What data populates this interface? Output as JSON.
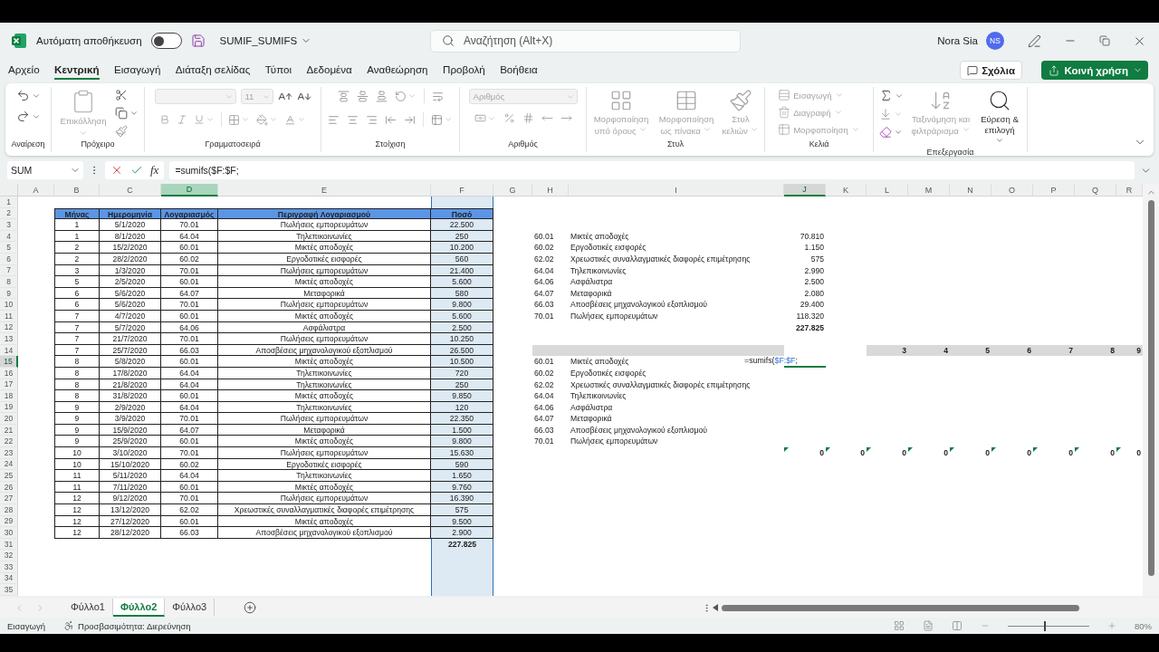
{
  "window": {
    "autosave_label": "Αυτόματη αποθήκευση",
    "autosave_on": false,
    "filename": "SUMIF_SUMIFS",
    "search_placeholder": "Αναζήτηση (Alt+X)",
    "user_name": "Nora Sia",
    "user_initials": "NS"
  },
  "menu_tabs": [
    {
      "label": "Αρχείο",
      "selected": false
    },
    {
      "label": "Κεντρική",
      "selected": true
    },
    {
      "label": "Εισαγωγή",
      "selected": false
    },
    {
      "label": "Διάταξη σελίδας",
      "selected": false
    },
    {
      "label": "Τύποι",
      "selected": false
    },
    {
      "label": "Δεδομένα",
      "selected": false
    },
    {
      "label": "Αναθεώρηση",
      "selected": false
    },
    {
      "label": "Προβολή",
      "selected": false
    },
    {
      "label": "Βοήθεια",
      "selected": false
    }
  ],
  "header_buttons": {
    "comments": "Σχόλια",
    "share": "Κοινή χρήση"
  },
  "ribbon": {
    "groups": [
      {
        "kind": "undo",
        "label": "Αναίρεση"
      },
      {
        "kind": "clipboard",
        "label": "Πρόχειρο",
        "paste": {
          "label": "Επικόλληση",
          "disabled": true
        }
      },
      {
        "kind": "font",
        "label": "Γραμματοσειρά",
        "font_size": "11"
      },
      {
        "kind": "alignment",
        "label": "Στοίχιση"
      },
      {
        "kind": "number",
        "label": "Αριθμός",
        "format": "Αριθμός"
      },
      {
        "kind": "styles",
        "label": "Στυλ",
        "buttons": [
          {
            "label": "Μορφοποίηση υπό όρους",
            "disabled": true
          },
          {
            "label": "Μορφοποίηση ως πίνακα",
            "disabled": true
          },
          {
            "label": "Στυλ κελιών",
            "disabled": true
          }
        ]
      },
      {
        "kind": "cells",
        "label": "Κελιά",
        "buttons": [
          {
            "label": "Εισαγωγή",
            "disabled": true
          },
          {
            "label": "Διαγραφή",
            "disabled": true
          },
          {
            "label": "Μορφοποίηση",
            "disabled": true
          }
        ]
      },
      {
        "kind": "editing",
        "label": "Επεξεργασία",
        "buttons": [
          {
            "label": "Ταξινόμηση και φιλτράρισμα",
            "disabled": true
          },
          {
            "label": "Εύρεση & επιλογή",
            "disabled": false
          }
        ]
      }
    ]
  },
  "formula_bar": {
    "name_box": "SUM",
    "function_symbol": "fx",
    "formula": "=sumifs($F:$F;"
  },
  "columns": [
    {
      "label": "A",
      "selected": false,
      "active": false
    },
    {
      "label": "B",
      "selected": false,
      "active": false
    },
    {
      "label": "C",
      "selected": false,
      "active": false
    },
    {
      "label": "D",
      "selected": true,
      "active": false
    },
    {
      "label": "E",
      "selected": false,
      "active": false
    },
    {
      "label": "F",
      "selected": false,
      "active": false
    },
    {
      "label": "G",
      "selected": false,
      "active": false
    },
    {
      "label": "H",
      "selected": false,
      "active": false
    },
    {
      "label": "I",
      "selected": false,
      "active": false
    },
    {
      "label": "J",
      "selected": false,
      "active": true
    },
    {
      "label": "K",
      "selected": false,
      "active": false
    },
    {
      "label": "L",
      "selected": false,
      "active": false
    },
    {
      "label": "M",
      "selected": false,
      "active": false
    },
    {
      "label": "N",
      "selected": false,
      "active": false
    },
    {
      "label": "O",
      "selected": false,
      "active": false
    },
    {
      "label": "P",
      "selected": false,
      "active": false
    },
    {
      "label": "Q",
      "selected": false,
      "active": false
    },
    {
      "label": "R",
      "selected": false,
      "active": false
    }
  ],
  "rows": [
    {
      "label": "1",
      "active": false
    },
    {
      "label": "2",
      "active": false
    },
    {
      "label": "3",
      "active": false
    },
    {
      "label": "4",
      "active": false
    },
    {
      "label": "5",
      "active": false
    },
    {
      "label": "6",
      "active": false
    },
    {
      "label": "7",
      "active": false
    },
    {
      "label": "8",
      "active": false
    },
    {
      "label": "9",
      "active": false
    },
    {
      "label": "10",
      "active": false
    },
    {
      "label": "11",
      "active": false
    },
    {
      "label": "12",
      "active": false
    },
    {
      "label": "13",
      "active": false
    },
    {
      "label": "14",
      "active": false
    },
    {
      "label": "15",
      "active": true
    },
    {
      "label": "16",
      "active": false
    },
    {
      "label": "17",
      "active": false
    },
    {
      "label": "18",
      "active": false
    },
    {
      "label": "19",
      "active": false
    },
    {
      "label": "20",
      "active": false
    },
    {
      "label": "21",
      "active": false
    },
    {
      "label": "22",
      "active": false
    },
    {
      "label": "23",
      "active": false
    },
    {
      "label": "24",
      "active": false
    },
    {
      "label": "25",
      "active": false
    },
    {
      "label": "26",
      "active": false
    },
    {
      "label": "27",
      "active": false
    },
    {
      "label": "28",
      "active": false
    },
    {
      "label": "29",
      "active": false
    },
    {
      "label": "30",
      "active": false
    },
    {
      "label": "31",
      "active": false
    },
    {
      "label": "32",
      "active": false
    },
    {
      "label": "33",
      "active": false
    },
    {
      "label": "34",
      "active": false
    },
    {
      "label": "35",
      "active": false
    }
  ],
  "table": {
    "headers": [
      "Μήνας",
      "Ημερομηνία",
      "Λογαριασμός",
      "Περιγραφή Λογαριασμού",
      "Ποσό"
    ],
    "rows": [
      [
        "1",
        "5/1/2020",
        "70.01",
        "Πωλήσεις εμπορευμάτων",
        "22.500"
      ],
      [
        "1",
        "8/1/2020",
        "64.04",
        "Τηλεπικοινωνίες",
        "250"
      ],
      [
        "2",
        "15/2/2020",
        "60.01",
        "Μικτές αποδοχές",
        "10.200"
      ],
      [
        "2",
        "28/2/2020",
        "60.02",
        "Εργοδοτικές εισφορές",
        "560"
      ],
      [
        "3",
        "1/3/2020",
        "70.01",
        "Πωλήσεις εμπορευμάτων",
        "21.400"
      ],
      [
        "5",
        "2/5/2020",
        "60.01",
        "Μικτές αποδοχές",
        "5.600"
      ],
      [
        "6",
        "5/6/2020",
        "64.07",
        "Μεταφορικά",
        "580"
      ],
      [
        "6",
        "5/6/2020",
        "70.01",
        "Πωλήσεις εμπορευμάτων",
        "9.800"
      ],
      [
        "7",
        "4/7/2020",
        "60.01",
        "Μικτές αποδοχές",
        "5.600"
      ],
      [
        "7",
        "5/7/2020",
        "64.06",
        "Ασφάλιστρα",
        "2.500"
      ],
      [
        "7",
        "21/7/2020",
        "70.01",
        "Πωλήσεις εμπορευμάτων",
        "10.250"
      ],
      [
        "7",
        "25/7/2020",
        "66.03",
        "Αποσβέσεις μηχανολογικού εξοπλισμού",
        "26.500"
      ],
      [
        "8",
        "5/8/2020",
        "60.01",
        "Μικτές αποδοχές",
        "10.500"
      ],
      [
        "8",
        "17/8/2020",
        "64.04",
        "Τηλεπικοινωνίες",
        "720"
      ],
      [
        "8",
        "21/8/2020",
        "64.04",
        "Τηλεπικοινωνίες",
        "250"
      ],
      [
        "8",
        "31/8/2020",
        "60.01",
        "Μικτές αποδοχές",
        "9.850"
      ],
      [
        "9",
        "2/9/2020",
        "64.04",
        "Τηλεπικοινωνίες",
        "120"
      ],
      [
        "9",
        "3/9/2020",
        "70.01",
        "Πωλήσεις εμπορευμάτων",
        "22.350"
      ],
      [
        "9",
        "15/9/2020",
        "64.07",
        "Μεταφορικά",
        "1.500"
      ],
      [
        "9",
        "25/9/2020",
        "60.01",
        "Μικτές αποδοχές",
        "9.800"
      ],
      [
        "10",
        "3/10/2020",
        "70.01",
        "Πωλήσεις εμπορευμάτων",
        "15.630"
      ],
      [
        "10",
        "15/10/2020",
        "60.02",
        "Εργοδοτικές εισφορές",
        "590"
      ],
      [
        "11",
        "5/11/2020",
        "64.04",
        "Τηλεπικοινωνίες",
        "1.650"
      ],
      [
        "11",
        "7/11/2020",
        "60.01",
        "Μικτές αποδοχές",
        "9.760"
      ],
      [
        "12",
        "9/12/2020",
        "70.01",
        "Πωλήσεις εμπορευμάτων",
        "16.390"
      ],
      [
        "12",
        "13/12/2020",
        "62.02",
        "Χρεωστικές συναλλαγματικές διαφορές επιμέτρησης",
        "575"
      ],
      [
        "12",
        "27/12/2020",
        "60.01",
        "Μικτές αποδοχές",
        "9.500"
      ],
      [
        "12",
        "28/12/2020",
        "66.03",
        "Αποσβέσεις μηχανολογικού εξοπλισμού",
        "2.900"
      ]
    ],
    "total": "227.825"
  },
  "summary": {
    "rows": [
      {
        "code": "60.01",
        "description": "Μικτές αποδοχές",
        "amount": "70.810"
      },
      {
        "code": "60.02",
        "description": "Εργοδοτικές εισφορές",
        "amount": "1.150"
      },
      {
        "code": "62.02",
        "description": "Χρεωστικές συναλλαγματικές διαφορές επιμέτρησης",
        "amount": "575"
      },
      {
        "code": "64.04",
        "description": "Τηλεπικοινωνίες",
        "amount": "2.990"
      },
      {
        "code": "64.06",
        "description": "Ασφάλιστρα",
        "amount": "2.500"
      },
      {
        "code": "64.07",
        "description": "Μεταφορικά",
        "amount": "2.080"
      },
      {
        "code": "66.03",
        "description": "Αποσβέσεις μηχανολογικού εξοπλισμού",
        "amount": "29.400"
      },
      {
        "code": "70.01",
        "description": "Πωλήσεις εμπορευμάτων",
        "amount": "118.320"
      }
    ],
    "total": "227.825"
  },
  "breakdown": {
    "headers": [
      "3",
      "4",
      "5",
      "6",
      "7",
      "8",
      "9"
    ],
    "rows": [
      {
        "code": "60.01",
        "description": "Μικτές αποδοχές"
      },
      {
        "code": "60.02",
        "description": "Εργοδοτικές εισφορές"
      },
      {
        "code": "62.02",
        "description": "Χρεωστικές συναλλαγματικές διαφορές επιμέτρησης"
      },
      {
        "code": "64.04",
        "description": "Τηλεπικοινωνίες"
      },
      {
        "code": "64.06",
        "description": "Ασφάλιστρα"
      },
      {
        "code": "64.07",
        "description": "Μεταφορικά"
      },
      {
        "code": "66.03",
        "description": "Αποσβέσεις μηχανολογικού εξοπλισμού"
      },
      {
        "code": "70.01",
        "description": "Πωλήσεις εμπορευμάτων"
      }
    ],
    "editing_formula": [
      {
        "kind": "plain",
        "text": "=sumifs("
      },
      {
        "kind": "reference",
        "text": "$F:$F"
      },
      {
        "kind": "plain",
        "text": ";"
      }
    ],
    "zeros": [
      "0",
      "0",
      "0",
      "0",
      "0",
      "0",
      "0",
      "0",
      "0"
    ]
  },
  "sheets": [
    {
      "label": "Φύλλο1",
      "selected": false
    },
    {
      "label": "Φύλλο2",
      "selected": true
    },
    {
      "label": "Φύλλο3",
      "selected": false
    }
  ],
  "status_bar": {
    "mode": "Εισαγωγή",
    "accessibility": "Προσβασιμότητα: Διερεύνηση",
    "zoom": "80%",
    "zoom_slider": {
      "level": 0.45
    }
  }
}
